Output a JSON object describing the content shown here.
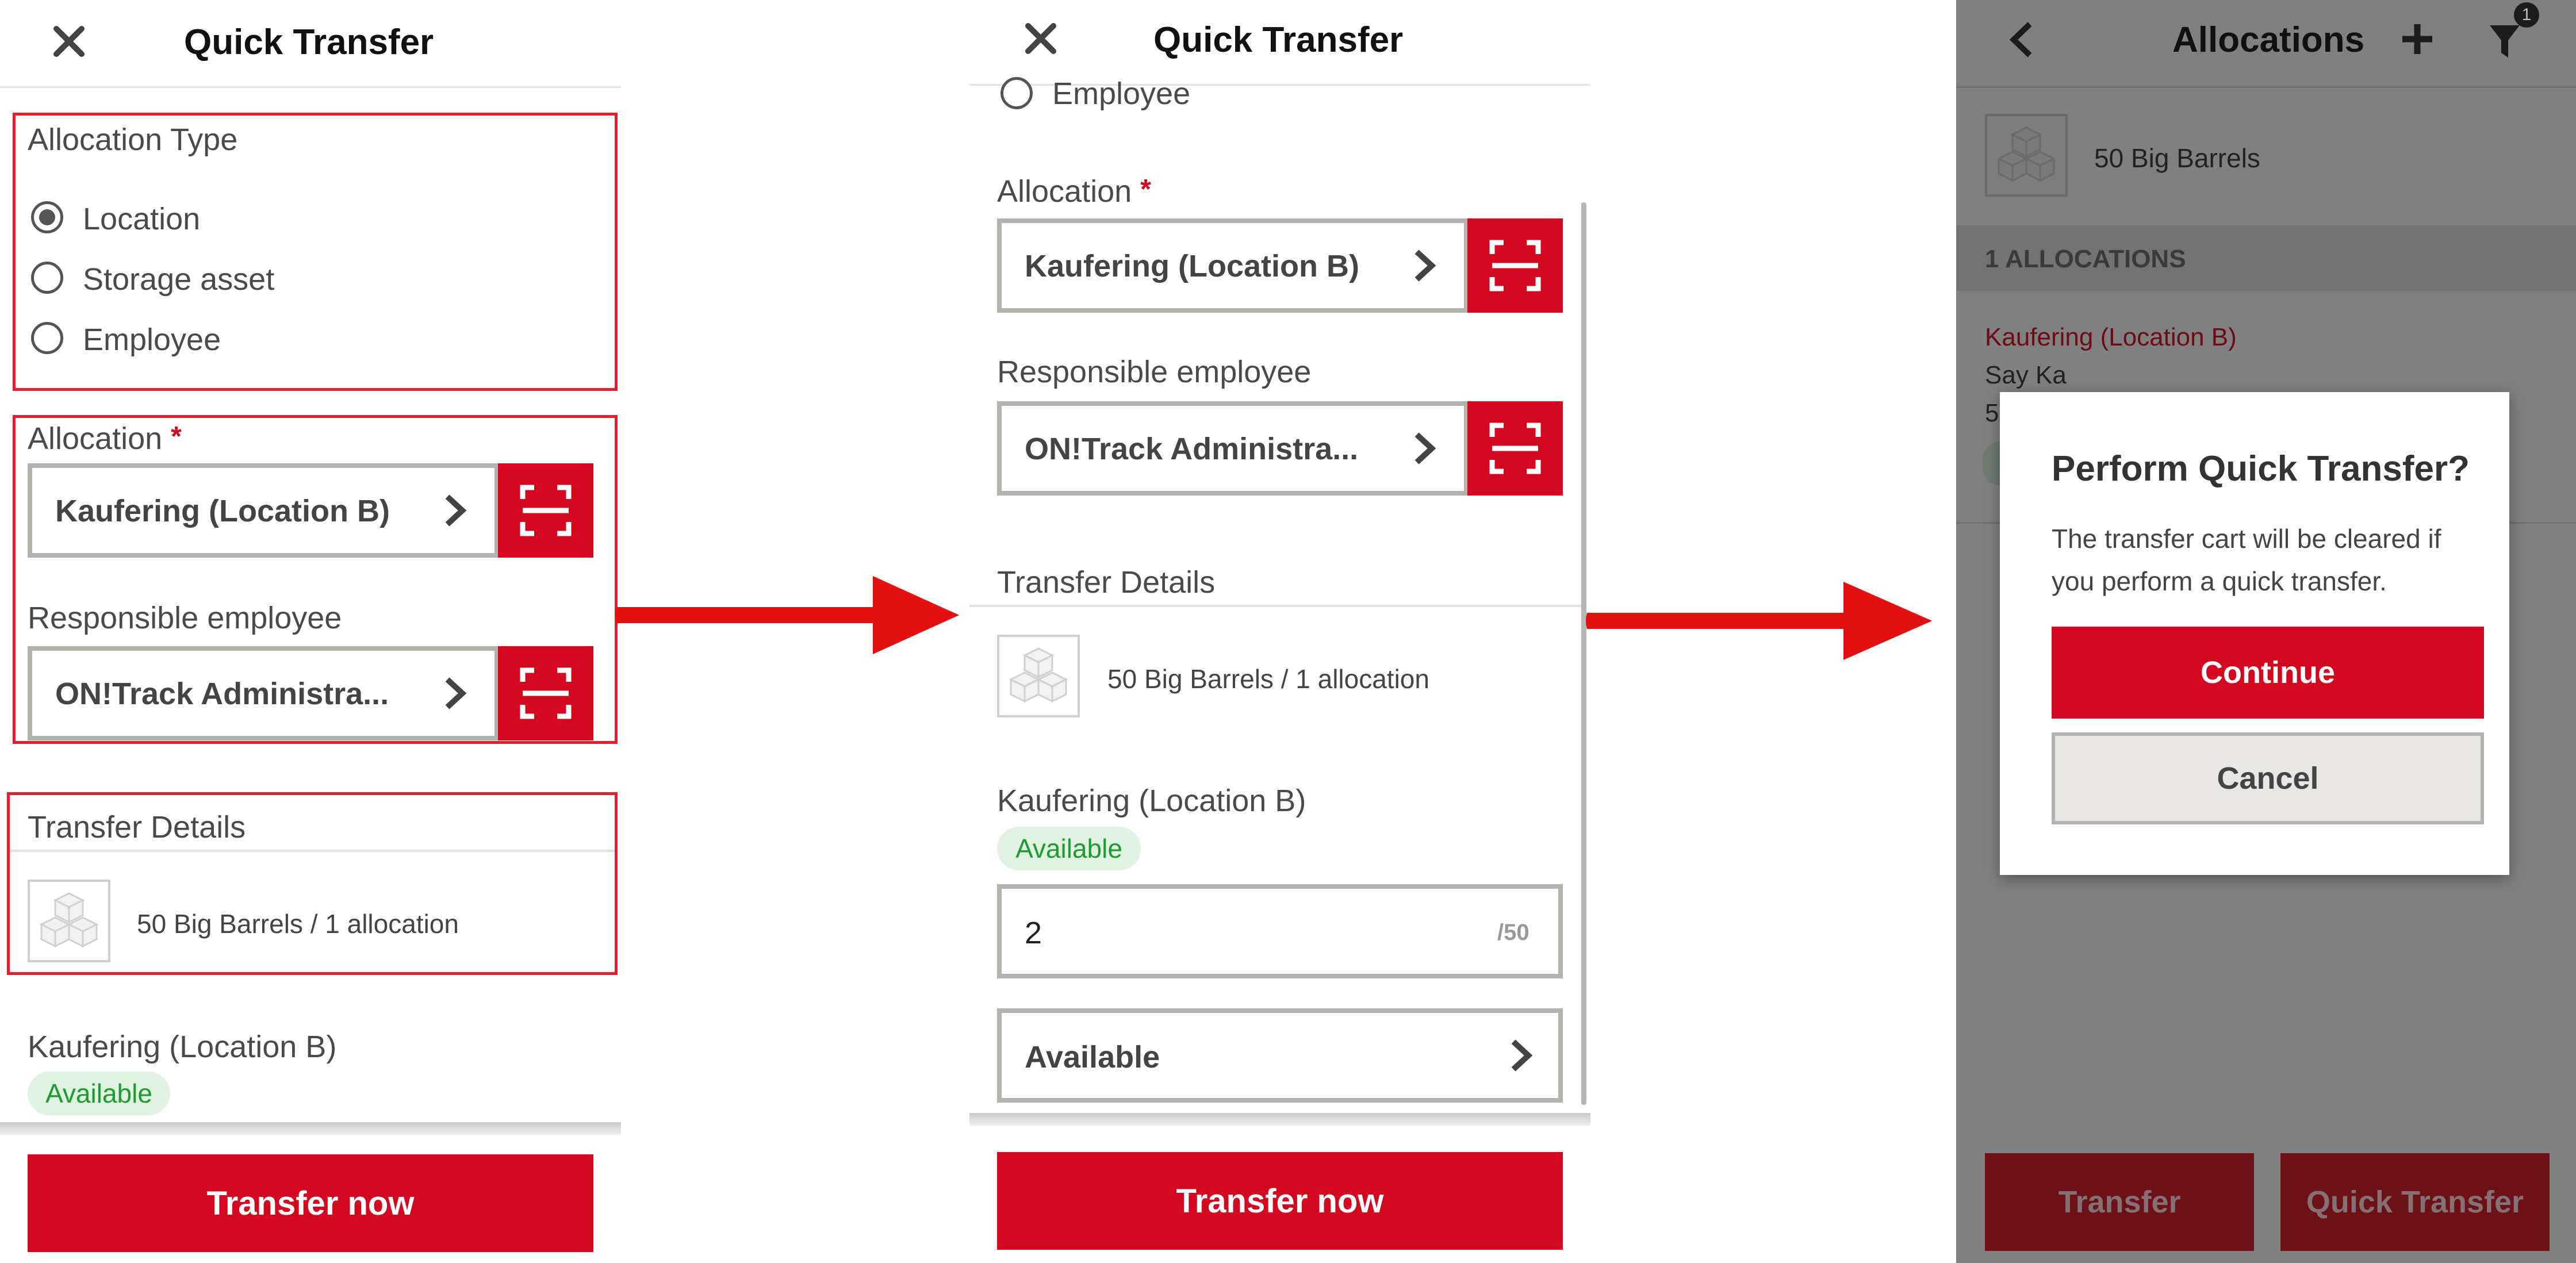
{
  "colors": {
    "brand_red": "#d3071f",
    "success_green": "#1e9a32",
    "overlay_gray": "#808080"
  },
  "screen1": {
    "title": "Quick Transfer",
    "allocation_type": {
      "label": "Allocation Type",
      "options": [
        "Location",
        "Storage asset",
        "Employee"
      ],
      "selected": "Location"
    },
    "allocation": {
      "label": "Allocation",
      "required_mark": "*",
      "value": "Kaufering (Location B)"
    },
    "responsible_employee": {
      "label": "Responsible employee",
      "value": "ON!Track Administra..."
    },
    "transfer_details": {
      "label": "Transfer Details",
      "summary": "50 Big Barrels / 1 allocation"
    },
    "location": {
      "name": "Kaufering (Location B)",
      "status": "Available"
    },
    "transfer_button": "Transfer now"
  },
  "screen2": {
    "title": "Quick Transfer",
    "partial_option": "Employee",
    "allocation": {
      "label": "Allocation",
      "required_mark": "*",
      "value": "Kaufering (Location B)"
    },
    "responsible_employee": {
      "label": "Responsible employee",
      "value": "ON!Track Administra..."
    },
    "transfer_details": {
      "label": "Transfer Details",
      "summary": "50 Big Barrels / 1 allocation"
    },
    "location": {
      "name": "Kaufering (Location B)",
      "status": "Available"
    },
    "quantity": {
      "value": "2",
      "max": "/50"
    },
    "status_select": "Available",
    "transfer_button": "Transfer now"
  },
  "screen3": {
    "title": "Allocations",
    "filter_count": "1",
    "item_name": "50 Big Barrels",
    "section_header": "1 ALLOCATIONS",
    "allocation_location": "Kaufering (Location B)",
    "allocation_employee": "Say Ka",
    "allocation_partial": "5",
    "dialog": {
      "title": "Perform Quick Transfer?",
      "message_line1": "The transfer cart will be cleared if",
      "message_line2": "you perform a quick transfer.",
      "continue": "Continue",
      "cancel": "Cancel"
    },
    "footer": {
      "transfer": "Transfer",
      "quick_transfer": "Quick Transfer"
    }
  }
}
